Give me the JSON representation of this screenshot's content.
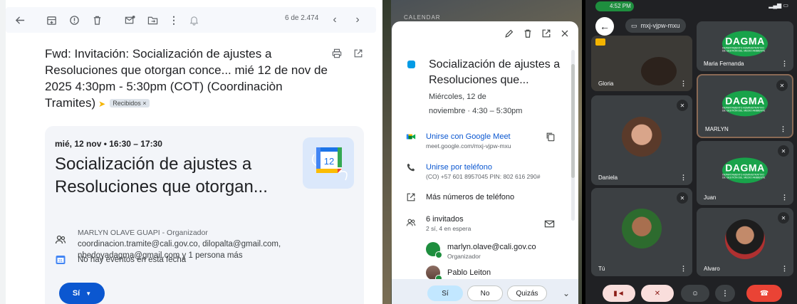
{
  "gmail": {
    "counter": "6 de 2.474",
    "subject": "Fwd: Invitación: Socialización de ajustes a Resoluciones que otorgan conce... mié 12 de nov de 2025 4:30pm - 5:30pm (COT) (Coordinaciòn Tramites)",
    "label": "Recibidos ×",
    "event": {
      "when": "mié, 12 nov • 16:30 – 17:30",
      "title": "Socialización de ajustes a Resoluciones que otorgan...",
      "logo_day": "12",
      "organizer": "MARLYN OLAVE GUAPI - Organizador",
      "guests_line1": "coordinacion.tramite@cali.gov.co, dilopalta@gmail.com,",
      "guests_line2": "nbedoyadagma@gmail.com y 1 persona más",
      "no_events": "No hay eventos en esta fecha",
      "rsvp": "Sí"
    }
  },
  "background": {
    "calendar_label": "CALENDAR"
  },
  "calendar": {
    "title": "Socialización de ajustes a Resoluciones que...",
    "date_line1": "Miércoles, 12 de",
    "date_line2": "noviembre  ·  4:30 – 5:30pm",
    "meet_label": "Unirse con Google Meet",
    "meet_url": "meet.google.com/mxj-vjpw-mxu",
    "phone_label": "Unirse por teléfono",
    "phone_detail": "(CO) +57 601 8957045 PIN: 802 616 290#",
    "more_numbers": "Más números de teléfono",
    "guests_count": "6 invitados",
    "guests_detail": "2 sí, 4 en espera",
    "guest1_email": "marlyn.olave@cali.gov.co",
    "guest1_role": "Organizador",
    "guest2_name": "Pablo Leiton",
    "rsvp_yes": "Sí",
    "rsvp_no": "No",
    "rsvp_maybe": "Quizás"
  },
  "meet": {
    "status_time": "4:52 PM",
    "meeting_code": "mxj-vjpw-mxu",
    "participants": {
      "gloria": "Gloria",
      "maria": "Maria Fernanda",
      "marlyn": "MARLYN",
      "daniela": "Daniela",
      "juan": "Juan",
      "tu": "Tú",
      "alvaro": "Alvaro"
    },
    "dagma_logo": "DAGMA",
    "dagma_sub": "DEPARTAMENTO ADMINISTRATIVO DE GESTIÓN DEL MEDIO AMBIENTE"
  },
  "colors": {
    "gmail_blue": "#0b57d0",
    "meet_red": "#ea4335",
    "dagma_green": "#18a34a"
  }
}
